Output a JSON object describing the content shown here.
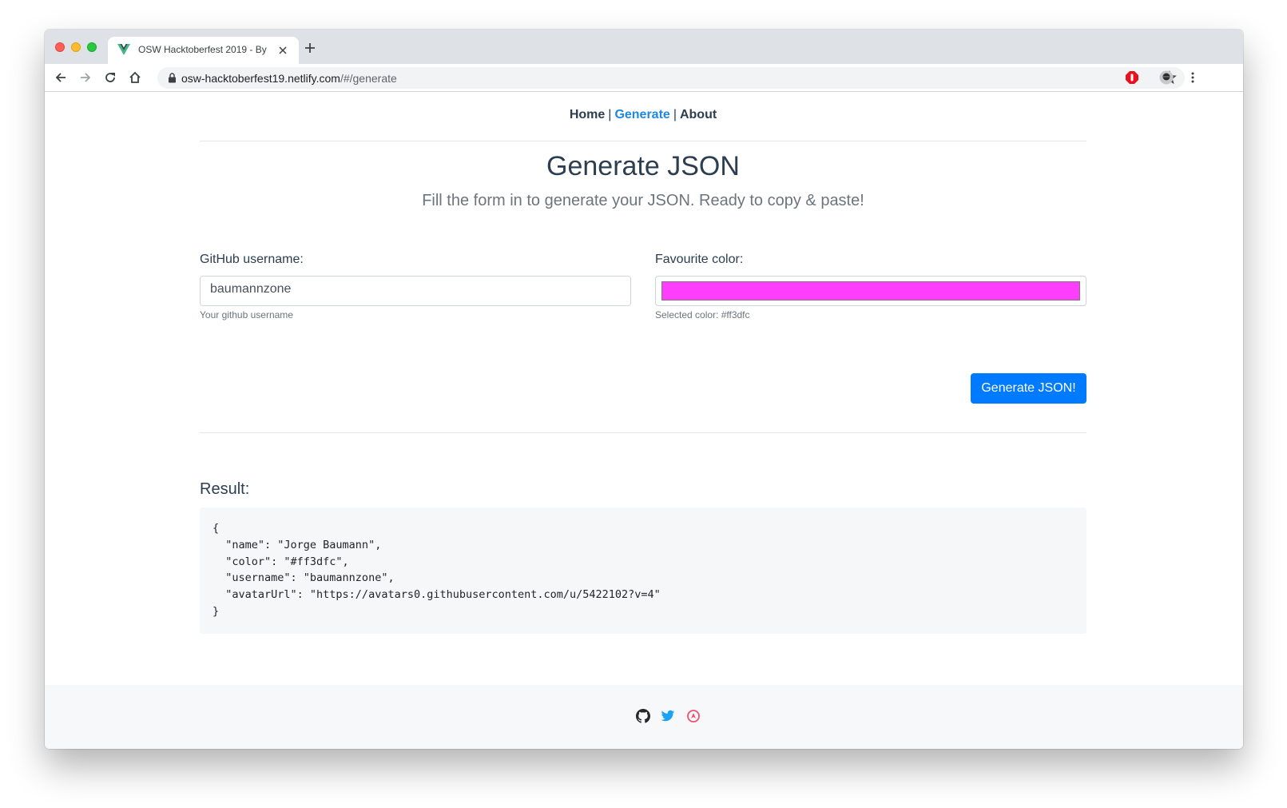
{
  "browser": {
    "tab_title": "OSW Hacktoberfest 2019 - By",
    "url_host": "osw-hacktoberfest19.netlify.com",
    "url_path": "/#/generate"
  },
  "nav": {
    "items": [
      "Home",
      "Generate",
      "About"
    ],
    "separator": "|",
    "active": "Generate"
  },
  "page": {
    "title": "Generate JSON",
    "subtitle": "Fill the form in to generate your JSON. Ready to copy & paste!"
  },
  "form": {
    "username_label": "GitHub username:",
    "username_value": "baumannzone",
    "username_help": "Your github username",
    "color_label": "Favourite color:",
    "color_value": "#ff3dfc",
    "color_help": "Selected color: #ff3dfc",
    "submit_label": "Generate JSON!"
  },
  "result": {
    "label": "Result:",
    "code": "{\n  \"name\": \"Jorge Baumann\",\n  \"color\": \"#ff3dfc\",\n  \"username\": \"baumannzone\",\n  \"avatarUrl\": \"https://avatars0.githubusercontent.com/u/5422102?v=4\"\n}"
  },
  "footer": {
    "icons": [
      "github-icon",
      "twitter-icon",
      "rocket-icon"
    ]
  },
  "colors": {
    "accent": "#007bff",
    "nav_active": "#1e88e5",
    "text": "#2c3e50",
    "swatch": "#ff3dfc"
  }
}
